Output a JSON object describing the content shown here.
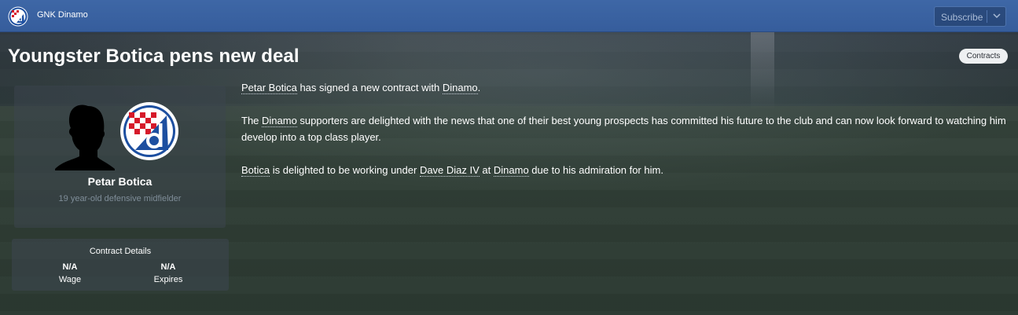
{
  "header": {
    "club_name": "GNK Dinamo",
    "subscribe_label": "Subscribe"
  },
  "news": {
    "headline": "Youngster Botica pens new deal",
    "category": "Contracts"
  },
  "player": {
    "name": "Petar Botica",
    "description": "19 year-old defensive midfielder"
  },
  "contract": {
    "title": "Contract Details",
    "wage_value": "N/A",
    "wage_label": "Wage",
    "expires_value": "N/A",
    "expires_label": "Expires"
  },
  "article": {
    "p1": {
      "player": "Petar Botica",
      "text1": " has signed a new contract with ",
      "club": "Dinamo",
      "text2": "."
    },
    "p2": {
      "text1": "The ",
      "club": "Dinamo",
      "text2": " supporters are delighted with the news that one of their best young prospects has committed his future to the club and can now look forward to watching him develop into a top class player."
    },
    "p3": {
      "player": "Botica",
      "text1": " is delighted to be working under ",
      "manager": "Dave Diaz IV",
      "text2": " at ",
      "club": "Dinamo",
      "text3": " due to his admiration for him."
    }
  },
  "colors": {
    "header_blue": "#3e67a6",
    "club_blue": "#1d4fa0",
    "club_red": "#d6192a"
  }
}
